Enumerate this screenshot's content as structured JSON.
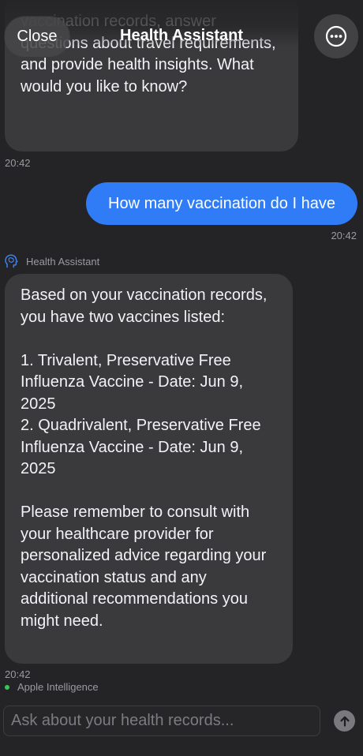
{
  "header": {
    "title": "Health Assistant",
    "close_label": "Close",
    "more_icon": "ellipsis-circle-icon"
  },
  "messages": {
    "assistant_intro": {
      "text": "vaccination records, answer questions about travel requirements, and provide health insights. What would you like to know?",
      "time": "20:42"
    },
    "user_question": {
      "text": "How many vaccination do I have",
      "time": "20:42"
    },
    "assistant_reply": {
      "sender": "Health Assistant",
      "sender_icon": "brain-head-icon",
      "text": "Based on your vaccination records, you have two vaccines listed:\n\n1. Trivalent, Preservative Free Influenza Vaccine - Date: Jun 9, 2025\n2. Quadrivalent, Preservative Free Influenza Vaccine - Date: Jun 9, 2025\n\nPlease remember to consult with your healthcare provider for personalized advice regarding your vaccination status and any additional recommendations you might need.",
      "time": "20:42",
      "source": "Apple Intelligence"
    }
  },
  "composer": {
    "placeholder": "Ask about your health records...",
    "value": "",
    "send_icon": "arrow-up-icon"
  },
  "colors": {
    "background": "#242426",
    "assistant_bubble": "#3a3a3c",
    "user_bubble": "#2f7cf6",
    "status_dot": "#34c759"
  }
}
